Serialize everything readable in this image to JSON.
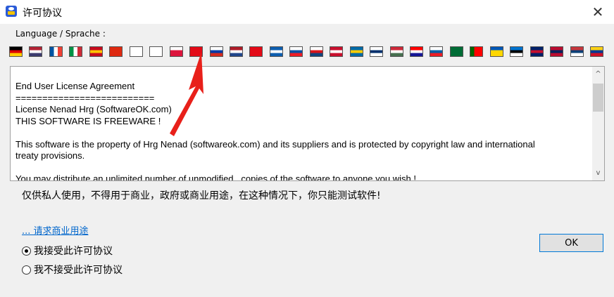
{
  "window": {
    "title": "许可协议",
    "close_symbol": "✕"
  },
  "language": {
    "label": "Language / Sprache :",
    "flags": [
      {
        "name": "Germany",
        "colors": [
          "#000000",
          "#dd0000",
          "#ffce00"
        ],
        "dir": "h"
      },
      {
        "name": "USA",
        "colors": [
          "#b22234",
          "#ffffff",
          "#3c3b6e"
        ],
        "dir": "h"
      },
      {
        "name": "France",
        "colors": [
          "#0055a4",
          "#ffffff",
          "#ef4135"
        ],
        "dir": "v"
      },
      {
        "name": "Italy",
        "colors": [
          "#009246",
          "#ffffff",
          "#ce2b37"
        ],
        "dir": "v"
      },
      {
        "name": "Spain",
        "colors": [
          "#c60b1e",
          "#ffc400",
          "#c60b1e"
        ],
        "dir": "h"
      },
      {
        "name": "China",
        "colors": [
          "#de2910",
          "#de2910",
          "#de2910"
        ],
        "dir": "h"
      },
      {
        "name": "Japan",
        "colors": [
          "#ffffff",
          "#ffffff",
          "#ffffff"
        ],
        "dir": "h"
      },
      {
        "name": "Korea",
        "colors": [
          "#ffffff",
          "#ffffff",
          "#ffffff"
        ],
        "dir": "h"
      },
      {
        "name": "Poland",
        "colors": [
          "#ffffff",
          "#dc143c",
          "#dc143c"
        ],
        "dir": "h"
      },
      {
        "name": "Turkey",
        "colors": [
          "#e30a17",
          "#e30a17",
          "#e30a17"
        ],
        "dir": "h"
      },
      {
        "name": "Russia",
        "colors": [
          "#ffffff",
          "#0039a6",
          "#d52b1e"
        ],
        "dir": "h"
      },
      {
        "name": "Netherlands",
        "colors": [
          "#ae1c28",
          "#ffffff",
          "#21468b"
        ],
        "dir": "h"
      },
      {
        "name": "Turkey2",
        "colors": [
          "#e30a17",
          "#e30a17",
          "#e30a17"
        ],
        "dir": "h"
      },
      {
        "name": "Greece",
        "colors": [
          "#0d5eaf",
          "#ffffff",
          "#0d5eaf"
        ],
        "dir": "h"
      },
      {
        "name": "Slovakia",
        "colors": [
          "#ffffff",
          "#0b4ea2",
          "#ee1c25"
        ],
        "dir": "h"
      },
      {
        "name": "Czech",
        "colors": [
          "#ffffff",
          "#d7141a",
          "#11457e"
        ],
        "dir": "h"
      },
      {
        "name": "Denmark",
        "colors": [
          "#c8102e",
          "#ffffff",
          "#c8102e"
        ],
        "dir": "h"
      },
      {
        "name": "Sweden",
        "colors": [
          "#006aa7",
          "#fecc00",
          "#006aa7"
        ],
        "dir": "h"
      },
      {
        "name": "Finland",
        "colors": [
          "#ffffff",
          "#002f6c",
          "#ffffff"
        ],
        "dir": "h"
      },
      {
        "name": "Hungary",
        "colors": [
          "#ce2939",
          "#ffffff",
          "#477050"
        ],
        "dir": "h"
      },
      {
        "name": "Croatia",
        "colors": [
          "#ff0000",
          "#ffffff",
          "#171796"
        ],
        "dir": "h"
      },
      {
        "name": "Slovenia",
        "colors": [
          "#ffffff",
          "#005da4",
          "#ed1c24"
        ],
        "dir": "h"
      },
      {
        "name": "Arabic",
        "colors": [
          "#006c35",
          "#006c35",
          "#006c35"
        ],
        "dir": "h"
      },
      {
        "name": "Portugal",
        "colors": [
          "#006600",
          "#ff0000",
          "#ff0000"
        ],
        "dir": "v"
      },
      {
        "name": "Ukraine",
        "colors": [
          "#0057b7",
          "#ffd700",
          "#ffd700"
        ],
        "dir": "h"
      },
      {
        "name": "Estonia",
        "colors": [
          "#0072ce",
          "#000000",
          "#ffffff"
        ],
        "dir": "h"
      },
      {
        "name": "UK",
        "colors": [
          "#012169",
          "#c8102e",
          "#012169"
        ],
        "dir": "h"
      },
      {
        "name": "Norway",
        "colors": [
          "#ba0c2f",
          "#00205b",
          "#ba0c2f"
        ],
        "dir": "h"
      },
      {
        "name": "Serbia",
        "colors": [
          "#c6363c",
          "#0c4076",
          "#ffffff"
        ],
        "dir": "h"
      },
      {
        "name": "Colombia",
        "colors": [
          "#fcd116",
          "#003893",
          "#ce1126"
        ],
        "dir": "h"
      }
    ]
  },
  "license_text": "End User License Agreement\n==========================\nLicense Nenad Hrg (SoftwareOK.com)\nTHIS SOFTWARE IS FREEWARE !\n\nThis software is the property of Hrg Nenad (softwareok.com) and its suppliers and is protected by copyright law and international\ntreaty provisions.\n\nYou may distribute an unlimited number of unmodified , copies of the software to anyone you wish !",
  "notice": "仅供私人使用，不得用于商业，政府或商业用途，在这种情况下，你只能测试软件!",
  "commercial_link": "... 请求商业用途",
  "radio_accept": "我接受此许可协议",
  "radio_decline": "我不接受此许可协议",
  "ok_label": "OK",
  "scroll_up": "^",
  "scroll_down": "v",
  "accent_color": "#0078d7",
  "arrow_color": "#e8201a"
}
